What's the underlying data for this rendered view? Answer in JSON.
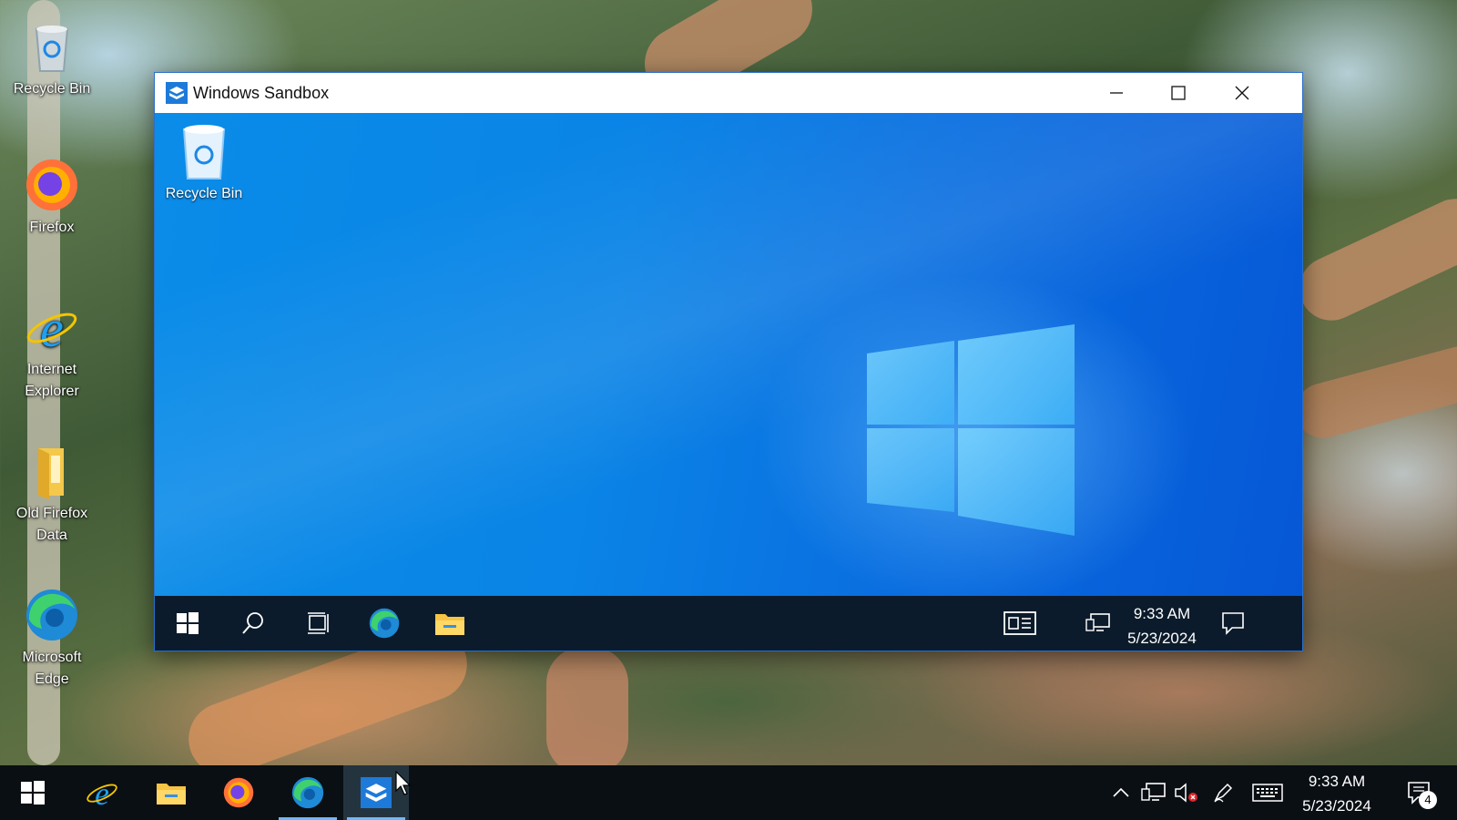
{
  "desktop": {
    "icons": [
      {
        "label": "Recycle Bin",
        "icon": "recycle-bin-icon"
      },
      {
        "label": "Firefox",
        "icon": "firefox-icon"
      },
      {
        "label": "Internet Explorer",
        "icon": "internet-explorer-icon"
      },
      {
        "label": "Old Firefox Data",
        "icon": "folder-icon"
      },
      {
        "label": "Microsoft Edge",
        "icon": "edge-icon"
      }
    ]
  },
  "sandbox_window": {
    "title": "Windows Sandbox",
    "controls": [
      "minimize",
      "maximize",
      "close"
    ],
    "inner_desktop": {
      "icons": [
        {
          "label": "Recycle Bin",
          "icon": "recycle-bin-icon"
        }
      ]
    },
    "taskbar": {
      "items": [
        "start-icon",
        "search-icon",
        "task-view-icon",
        "edge-icon",
        "file-explorer-icon"
      ],
      "tray": [
        "news-icon",
        "network-icon",
        "notifications-icon"
      ],
      "time": "9:33 AM",
      "date": "5/23/2024"
    }
  },
  "taskbar": {
    "items": [
      "start-icon",
      "internet-explorer-icon",
      "file-explorer-icon",
      "firefox-icon",
      "edge-icon",
      "windows-sandbox-icon"
    ],
    "active_item": "windows-sandbox-icon",
    "tray": [
      "chevron-up-icon",
      "network-icon",
      "volume-muted-icon",
      "pen-icon",
      "keyboard-icon"
    ],
    "time": "9:33 AM",
    "date": "5/23/2024",
    "notification_count": "4"
  },
  "colors": {
    "sandbox_blue": "#0a84e6",
    "taskbar": "#0a0f14",
    "accent": "#6fb8ff"
  }
}
